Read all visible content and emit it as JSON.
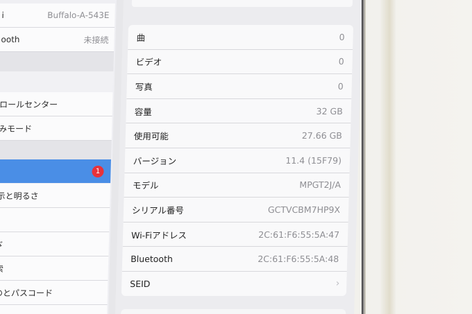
{
  "sidebar": {
    "wifi": {
      "label": "i",
      "value": "Buffalo-A-543E"
    },
    "bluetooth": {
      "label": "ooth",
      "value": "未接続"
    },
    "control_center": {
      "label": "ロールセンター"
    },
    "do_not_disturb": {
      "label": "みモード"
    },
    "general": {
      "label": "",
      "badge": "1"
    },
    "display": {
      "label": "示と明るさ"
    },
    "row7": {
      "label": ""
    },
    "wallpaper": {
      "label": "ゞ"
    },
    "search": {
      "label": "索"
    },
    "passcode": {
      "label": "のとパスコード"
    }
  },
  "about": {
    "rows": [
      {
        "key": "曲",
        "value": "0"
      },
      {
        "key": "ビデオ",
        "value": "0"
      },
      {
        "key": "写真",
        "value": "0"
      },
      {
        "key": "容量",
        "value": "32 GB"
      },
      {
        "key": "使用可能",
        "value": "27.66 GB"
      },
      {
        "key": "バージョン",
        "value": "11.4 (15F79)"
      },
      {
        "key": "モデル",
        "value": "MPGT2J/A"
      },
      {
        "key": "シリアル番号",
        "value": "GCTVCBM7HP9X"
      },
      {
        "key": "Wi-Fiアドレス",
        "value": "2C:61:F6:55:5A:47"
      },
      {
        "key": "Bluetooth",
        "value": "2C:61:F6:55:5A:48"
      }
    ],
    "seid": {
      "key": "SEID",
      "chevron": "›"
    }
  }
}
